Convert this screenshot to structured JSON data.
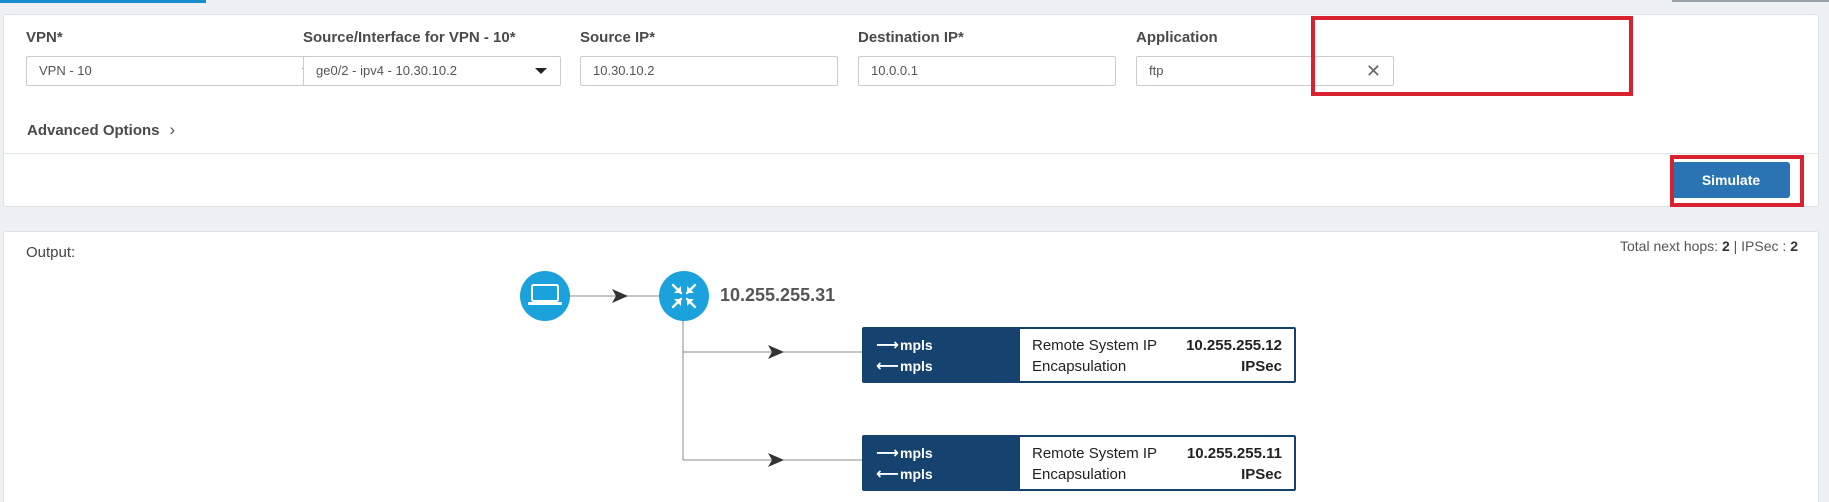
{
  "form": {
    "vpn": {
      "label": "VPN*",
      "value": "VPN - 10"
    },
    "source_interface": {
      "label": "Source/Interface for VPN - 10*",
      "value": "ge0/2 - ipv4 - 10.30.10.2"
    },
    "source_ip": {
      "label": "Source IP*",
      "value": "10.30.10.2"
    },
    "destination_ip": {
      "label": "Destination IP*",
      "value": "10.0.0.1"
    },
    "application": {
      "label": "Application",
      "value": "ftp"
    },
    "advanced_options": "Advanced Options",
    "simulate_label": "Simulate"
  },
  "output": {
    "title": "Output:",
    "summary": {
      "total_label": "Total next hops:",
      "total_value": "2",
      "separator": "|",
      "ipsec_label": "IPSec :",
      "ipsec_value": "2"
    },
    "device_ip": "10.255.255.31",
    "hops": [
      {
        "out_label": "mpls",
        "in_label": "mpls",
        "remote_label": "Remote System IP",
        "remote_value": "10.255.255.12",
        "encap_label": "Encapsulation",
        "encap_value": "IPSec"
      },
      {
        "out_label": "mpls",
        "in_label": "mpls",
        "remote_label": "Remote System IP",
        "remote_value": "10.255.255.11",
        "encap_label": "Encapsulation",
        "encap_value": "IPSec"
      }
    ]
  },
  "colors": {
    "accent": "#1a8ccf",
    "button": "#2b74b3",
    "highlight": "#d9222f",
    "hop_header": "#15426e",
    "node": "#1ba1dc"
  },
  "icons": {
    "source_node": "laptop-icon",
    "router_node": "router-icon",
    "dropdown": "caret-down-icon",
    "clear": "close-icon",
    "expand": "chevron-right-icon"
  }
}
